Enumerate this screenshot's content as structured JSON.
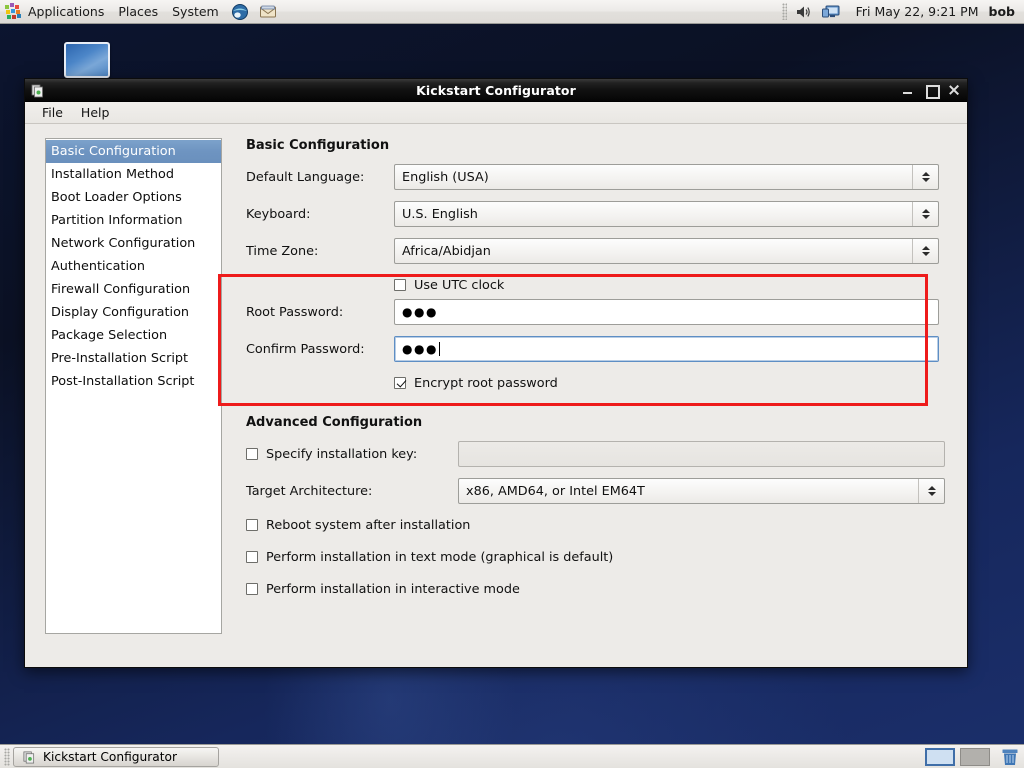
{
  "top_panel": {
    "apps_icon": "fedora-apps-icon",
    "menus": [
      "Applications",
      "Places",
      "System"
    ],
    "launchers": [
      "web-browser-icon",
      "email-client-icon"
    ],
    "tray": [
      "volume-icon",
      "display-icon"
    ],
    "clock": "Fri May 22,  9:21 PM",
    "user": "bob"
  },
  "desktop": {
    "icons": [
      {
        "name": "computer-icon",
        "label": ""
      }
    ]
  },
  "window": {
    "title": "Kickstart Configurator",
    "icon": "kickstart-icon",
    "controls": {
      "minimize": "minimize-button",
      "maximize": "maximize-button",
      "close": "close-button"
    },
    "menubar": [
      "File",
      "Help"
    ]
  },
  "sidebar": {
    "selected_index": 0,
    "items": [
      "Basic Configuration",
      "Installation Method",
      "Boot Loader Options",
      "Partition Information",
      "Network Configuration",
      "Authentication",
      "Firewall Configuration",
      "Display Configuration",
      "Package Selection",
      "Pre-Installation Script",
      "Post-Installation Script"
    ]
  },
  "basic": {
    "heading": "Basic Configuration",
    "language_label": "Default Language:",
    "language_value": "English (USA)",
    "keyboard_label": "Keyboard:",
    "keyboard_value": "U.S. English",
    "timezone_label": "Time Zone:",
    "timezone_value": "Africa/Abidjan",
    "utc_label": "Use UTC clock",
    "utc_checked": false,
    "root_password_label": "Root Password:",
    "root_password_value": "●●●",
    "confirm_password_label": "Confirm Password:",
    "confirm_password_value": "●●●",
    "encrypt_label": "Encrypt root password",
    "encrypt_checked": true,
    "highlight_color": "#ee1b1b"
  },
  "advanced": {
    "heading": "Advanced Configuration",
    "install_key_label": "Specify installation key:",
    "install_key_checked": false,
    "install_key_value": "",
    "target_arch_label": "Target Architecture:",
    "target_arch_value": "x86, AMD64, or Intel EM64T",
    "reboot_label": "Reboot system after installation",
    "reboot_checked": false,
    "text_mode_label": "Perform installation in text mode (graphical is default)",
    "text_mode_checked": false,
    "interactive_label": "Perform installation in interactive mode",
    "interactive_checked": false
  },
  "bottom_panel": {
    "task_button": "Kickstart Configurator",
    "task_icon": "kickstart-icon",
    "workspaces": [
      "workspace-1",
      "workspace-2"
    ],
    "active_workspace": 0,
    "trash": "trash-icon"
  }
}
